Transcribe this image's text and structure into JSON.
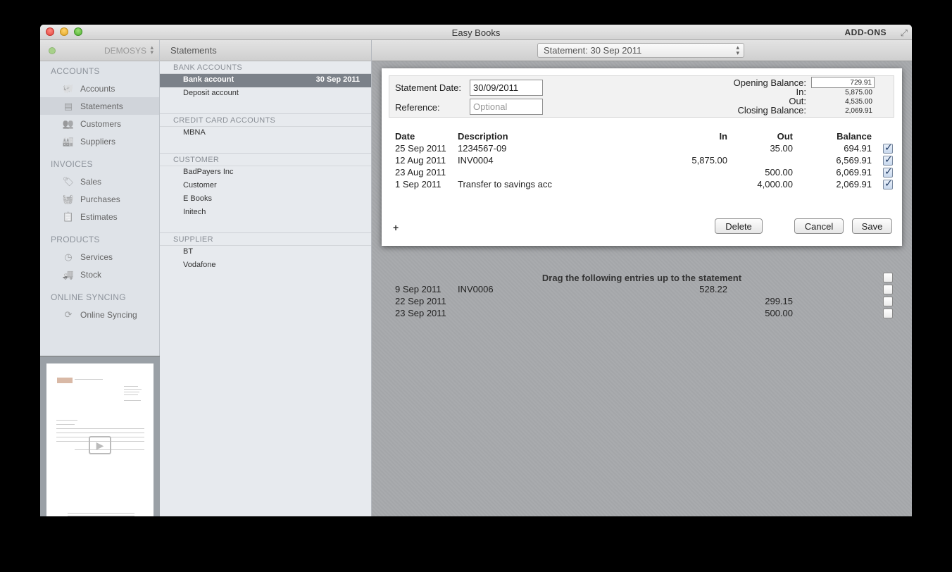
{
  "window": {
    "title": "Easy Books",
    "addons_label": "ADD-ONS"
  },
  "sidebar": {
    "company": "DEMOSYS",
    "sections": [
      {
        "title": "ACCOUNTS",
        "items": [
          {
            "label": "Accounts",
            "icon": "piggy-bank-icon",
            "selected": false
          },
          {
            "label": "Statements",
            "icon": "statement-icon",
            "selected": true
          },
          {
            "label": "Customers",
            "icon": "customers-icon",
            "selected": false
          },
          {
            "label": "Suppliers",
            "icon": "suppliers-icon",
            "selected": false
          }
        ]
      },
      {
        "title": "INVOICES",
        "items": [
          {
            "label": "Sales",
            "icon": "tag-icon",
            "selected": false
          },
          {
            "label": "Purchases",
            "icon": "basket-icon",
            "selected": false
          },
          {
            "label": "Estimates",
            "icon": "clipboard-icon",
            "selected": false
          }
        ]
      },
      {
        "title": "PRODUCTS",
        "items": [
          {
            "label": "Services",
            "icon": "clock-icon",
            "selected": false
          },
          {
            "label": "Stock",
            "icon": "truck-icon",
            "selected": false
          }
        ]
      },
      {
        "title": "ONLINE SYNCING",
        "items": [
          {
            "label": "Online Syncing",
            "icon": "sync-icon",
            "selected": false
          }
        ]
      }
    ]
  },
  "listpane": {
    "title": "Statements",
    "sections": [
      {
        "title": "BANK ACCOUNTS",
        "items": [
          {
            "label": "Bank account",
            "date": "30 Sep 2011",
            "selected": true
          },
          {
            "label": "Deposit account",
            "date": "",
            "selected": false
          }
        ]
      },
      {
        "title": "CREDIT CARD ACCOUNTS",
        "items": [
          {
            "label": "MBNA",
            "date": "",
            "selected": false
          }
        ]
      },
      {
        "title": "CUSTOMER",
        "items": [
          {
            "label": "BadPayers Inc",
            "date": "",
            "selected": false
          },
          {
            "label": "Customer",
            "date": "",
            "selected": false
          },
          {
            "label": "E Books",
            "date": "",
            "selected": false
          },
          {
            "label": "Initech",
            "date": "",
            "selected": false
          }
        ]
      },
      {
        "title": "SUPPLIER",
        "items": [
          {
            "label": "BT",
            "date": "",
            "selected": false
          },
          {
            "label": "Vodafone",
            "date": "",
            "selected": false
          }
        ]
      }
    ]
  },
  "main": {
    "statement_select": "Statement: 30 Sep 2011",
    "form": {
      "date_label": "Statement Date:",
      "date_value": "30/09/2011",
      "reference_label": "Reference:",
      "reference_placeholder": "Optional",
      "opening_label": "Opening Balance:",
      "opening_value": "729.91",
      "in_label": "In:",
      "in_value": "5,875.00",
      "out_label": "Out:",
      "out_value": "4,535.00",
      "closing_label": "Closing Balance:",
      "closing_value": "2,069.91"
    },
    "columns": {
      "date": "Date",
      "description": "Description",
      "in": "In",
      "out": "Out",
      "balance": "Balance"
    },
    "rows": [
      {
        "date": "25 Sep 2011",
        "description": "1234567-09",
        "in": "",
        "out": "35.00",
        "balance": "694.91",
        "checked": true
      },
      {
        "date": "12 Aug 2011",
        "description": "INV0004",
        "in": "5,875.00",
        "out": "",
        "balance": "6,569.91",
        "checked": true
      },
      {
        "date": "23 Aug 2011",
        "description": "",
        "in": "",
        "out": "500.00",
        "balance": "6,069.91",
        "checked": true
      },
      {
        "date": "1 Sep 2011",
        "description": "Transfer to savings acc",
        "in": "",
        "out": "4,000.00",
        "balance": "2,069.91",
        "checked": true
      }
    ],
    "add_label": "+",
    "delete_label": "Delete",
    "cancel_label": "Cancel",
    "save_label": "Save",
    "pending_title": "Drag the following entries up to the statement",
    "pending": [
      {
        "date": "9 Sep 2011",
        "description": "INV0006",
        "in": "528.22",
        "out": "",
        "checked": false
      },
      {
        "date": "22 Sep 2011",
        "description": "",
        "in": "",
        "out": "299.15",
        "checked": false
      },
      {
        "date": "23 Sep 2011",
        "description": "",
        "in": "",
        "out": "500.00",
        "checked": false
      }
    ]
  }
}
